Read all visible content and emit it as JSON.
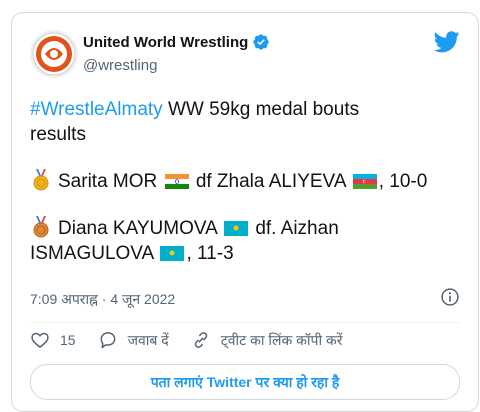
{
  "account": {
    "name": "United World Wrestling",
    "handle": "@wrestling"
  },
  "tweet": {
    "hashtag": "#WrestleAlmaty",
    "intro": " WW 59kg medal bouts",
    "intro_line2": "results",
    "bout1": {
      "winner": "Sarita MOR",
      "result_prefix": "df Zhala ALIYEVA",
      "score": ", 10-0"
    },
    "bout2": {
      "winner": "Diana KAYUMOVA",
      "result_prefix": "df. Aizhan",
      "loser_line2": "ISMAGULOVA",
      "score": ", 11-3"
    }
  },
  "meta": {
    "time": "7:09 अपराह्न",
    "separator": " · ",
    "date": "4 जून 2022"
  },
  "actions": {
    "likes": "15",
    "reply_label": "जवाब दें",
    "copy_link_label": "ट्वीट का लिंक कॉपी करें"
  },
  "cta": {
    "label": "पता लगाएं Twitter पर क्या हो रहा है"
  },
  "colors": {
    "accent": "#1d9bf0",
    "secondary_text": "#536471",
    "border": "#cfd9de"
  }
}
